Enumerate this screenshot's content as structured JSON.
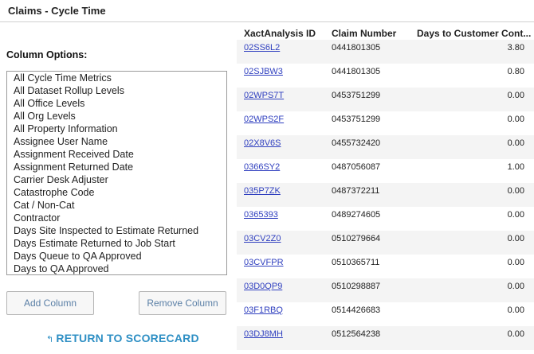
{
  "window": {
    "title": "Claims - Cycle Time"
  },
  "left": {
    "column_options_label": "Column Options:",
    "options": [
      "All Cycle Time Metrics",
      "All Dataset Rollup Levels",
      "All Office Levels",
      "All Org Levels",
      "All Property Information",
      "Assignee User Name",
      "Assignment Received Date",
      "Assignment Returned Date",
      "Carrier Desk Adjuster",
      "Catastrophe Code",
      "Cat / Non-Cat",
      "Contractor",
      "Days Site Inspected to Estimate Returned",
      "Days Estimate Returned to Job Start",
      "Days Queue to QA Approved",
      "Days to QA Approved"
    ],
    "add_button": "Add Column",
    "remove_button": "Remove Column",
    "return_link": "RETURN TO SCORECARD"
  },
  "table": {
    "headers": [
      "XactAnalysis ID",
      "Claim Number",
      "Days to Customer Cont..."
    ],
    "rows": [
      {
        "id": "02SS6L2",
        "claim": "0441801305",
        "days": "3.80"
      },
      {
        "id": "02SJBW3",
        "claim": "0441801305",
        "days": "0.80"
      },
      {
        "id": "02WPS7T",
        "claim": "0453751299",
        "days": "0.00"
      },
      {
        "id": "02WPS2F",
        "claim": "0453751299",
        "days": "0.00"
      },
      {
        "id": "02X8V6S",
        "claim": "0455732420",
        "days": "0.00"
      },
      {
        "id": "0366SY2",
        "claim": "0487056087",
        "days": "1.00"
      },
      {
        "id": "035P7ZK",
        "claim": "0487372211",
        "days": "0.00"
      },
      {
        "id": "0365393",
        "claim": "0489274605",
        "days": "0.00"
      },
      {
        "id": "03CV2Z0",
        "claim": "0510279664",
        "days": "0.00"
      },
      {
        "id": "03CVFPR",
        "claim": "0510365711",
        "days": "0.00"
      },
      {
        "id": "03D0QP9",
        "claim": "0510298887",
        "days": "0.00"
      },
      {
        "id": "03F1RBQ",
        "claim": "0514426683",
        "days": "0.00"
      },
      {
        "id": "03DJ8MH",
        "claim": "0512564238",
        "days": "0.00"
      }
    ]
  }
}
